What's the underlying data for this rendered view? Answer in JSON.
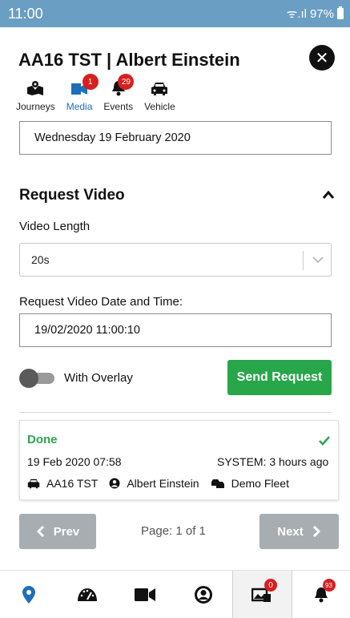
{
  "status_bar": {
    "time": "11:00",
    "signal": "ᯤ.ıl",
    "battery": "97%"
  },
  "header": {
    "title": "AA16 TST | Albert Einstein"
  },
  "tabs": [
    {
      "label": "Journeys",
      "icon": "journeys-map-icon",
      "badge": ""
    },
    {
      "label": "Media",
      "icon": "media-icon",
      "badge": "1"
    },
    {
      "label": "Events",
      "icon": "bell-icon",
      "badge": "29"
    },
    {
      "label": "Vehicle",
      "icon": "car-icon",
      "badge": ""
    }
  ],
  "date_selector": {
    "value": "Wednesday 19 February 2020"
  },
  "request_video": {
    "title": "Request Video",
    "length_label": "Video Length",
    "length_value": "20s",
    "datetime_label": "Request Video Date and Time:",
    "datetime_value": "19/02/2020 11:00:10",
    "overlay_label": "With Overlay",
    "overlay_on": false,
    "send_label": "Send Request"
  },
  "result": {
    "status": "Done",
    "date": "19 Feb 2020 07:58",
    "source": "SYSTEM: 3 hours ago",
    "vehicle": "AA16 TST",
    "driver": "Albert Einstein",
    "fleet": "Demo Fleet"
  },
  "pagination": {
    "prev_label": "Prev",
    "page_text": "Page: 1 of 1",
    "next_label": "Next"
  },
  "bottom_nav": [
    {
      "icon": "location-pin-icon",
      "badge": ""
    },
    {
      "icon": "speedometer-icon",
      "badge": ""
    },
    {
      "icon": "video-camera-icon",
      "badge": ""
    },
    {
      "icon": "user-icon",
      "badge": ""
    },
    {
      "icon": "media-icon",
      "badge": "0"
    },
    {
      "icon": "bell-icon",
      "badge": "93"
    }
  ],
  "colors": {
    "status_bar": "#6a9ec3",
    "accent": "#1e6fb8",
    "success": "#27a64a",
    "danger": "#d71f1f",
    "disabled": "#a8adb2"
  }
}
